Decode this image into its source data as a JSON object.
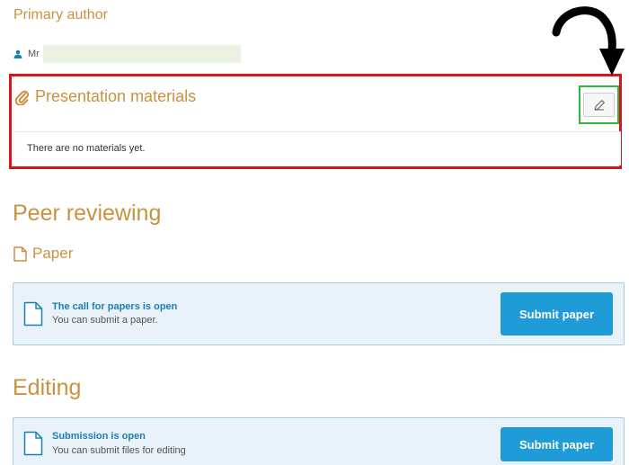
{
  "contribution": {
    "primary_author_heading": "Primary author",
    "author": {
      "prefix": "Mr"
    }
  },
  "materials": {
    "title": "Presentation materials",
    "empty_text": "There are no materials yet.",
    "edit_icon": "pencil-icon",
    "highlight_colors": {
      "section": "#d5161a",
      "edit_button": "#2fb540"
    }
  },
  "peer_reviewing": {
    "heading": "Peer reviewing",
    "paper_label": "Paper",
    "call": {
      "title": "The call for papers is open",
      "subtitle": "You can submit a paper.",
      "button_label": "Submit paper"
    }
  },
  "editing": {
    "heading": "Editing",
    "submission": {
      "title": "Submission is open",
      "subtitle": "You can submit files for editing",
      "button_label": "Submit paper"
    }
  },
  "colors": {
    "accent_heading": "#c9923f",
    "link_blue": "#1a7fb5",
    "button_blue": "#1f9bd8",
    "panel_bg": "#e9f2f8"
  }
}
